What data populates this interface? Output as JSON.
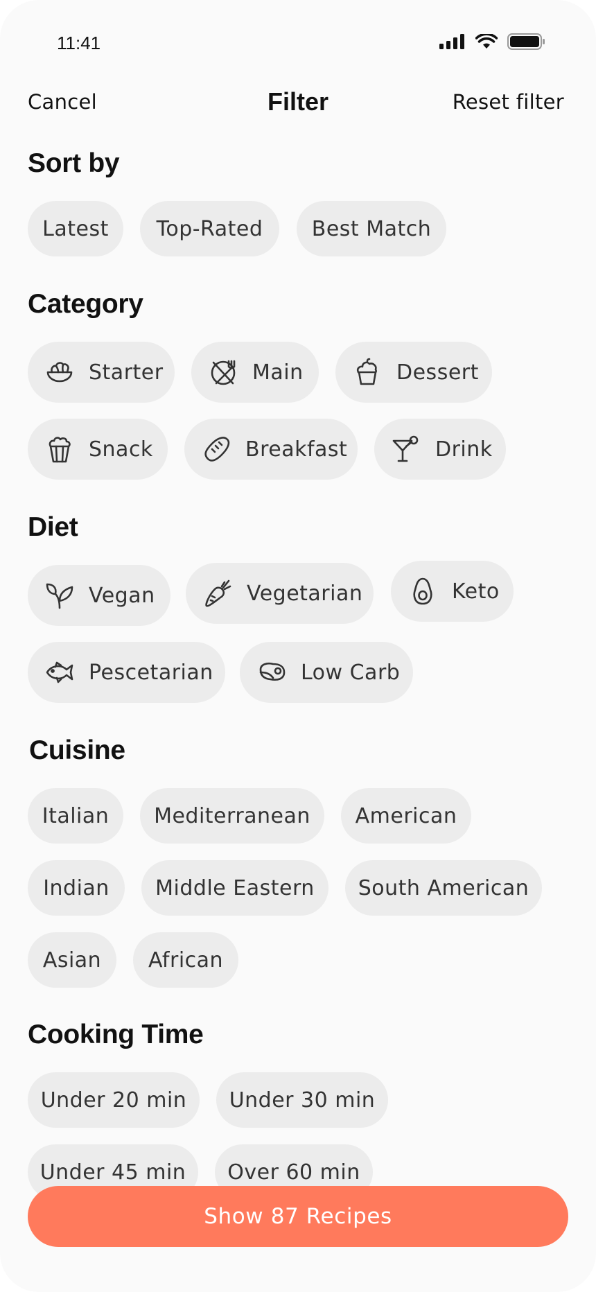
{
  "status_bar": {
    "time": "11:41"
  },
  "nav": {
    "cancel": "Cancel",
    "title": "Filter",
    "reset": "Reset filter"
  },
  "sort_by": {
    "title": "Sort  by",
    "options": [
      "Latest",
      "Top-Rated",
      "Best Match"
    ]
  },
  "category": {
    "title": "Category",
    "options": [
      {
        "label": "Starter",
        "icon": "salad-bowl-icon"
      },
      {
        "label": "Main",
        "icon": "plate-fork-knife-icon"
      },
      {
        "label": "Dessert",
        "icon": "cupcake-icon"
      },
      {
        "label": "Snack",
        "icon": "popcorn-icon"
      },
      {
        "label": "Breakfast",
        "icon": "bread-icon"
      },
      {
        "label": "Drink",
        "icon": "cocktail-icon"
      }
    ]
  },
  "diet": {
    "title": "Diet",
    "options": [
      {
        "label": "Vegan",
        "icon": "sprout-icon"
      },
      {
        "label": "Vegetarian",
        "icon": "carrot-icon"
      },
      {
        "label": "Keto",
        "icon": "avocado-icon"
      },
      {
        "label": "Pescetarian",
        "icon": "fish-icon"
      },
      {
        "label": "Low Carb",
        "icon": "steak-icon"
      }
    ]
  },
  "cuisine": {
    "title": "Cuisine",
    "options": [
      "Italian",
      "Mediterranean",
      "American",
      "Indian",
      "Middle Eastern",
      "South American",
      "Asian",
      "African"
    ]
  },
  "cooking_time": {
    "title": "Cooking Time",
    "options": [
      "Under 20 min",
      "Under 30 min",
      "Under 45 min",
      "Over 60 min"
    ]
  },
  "cta": {
    "label": "Show 87 Recipes"
  },
  "colors": {
    "background": "#fafafa",
    "chip": "#ececec",
    "accent": "#ff7a5c",
    "text": "#111111"
  }
}
